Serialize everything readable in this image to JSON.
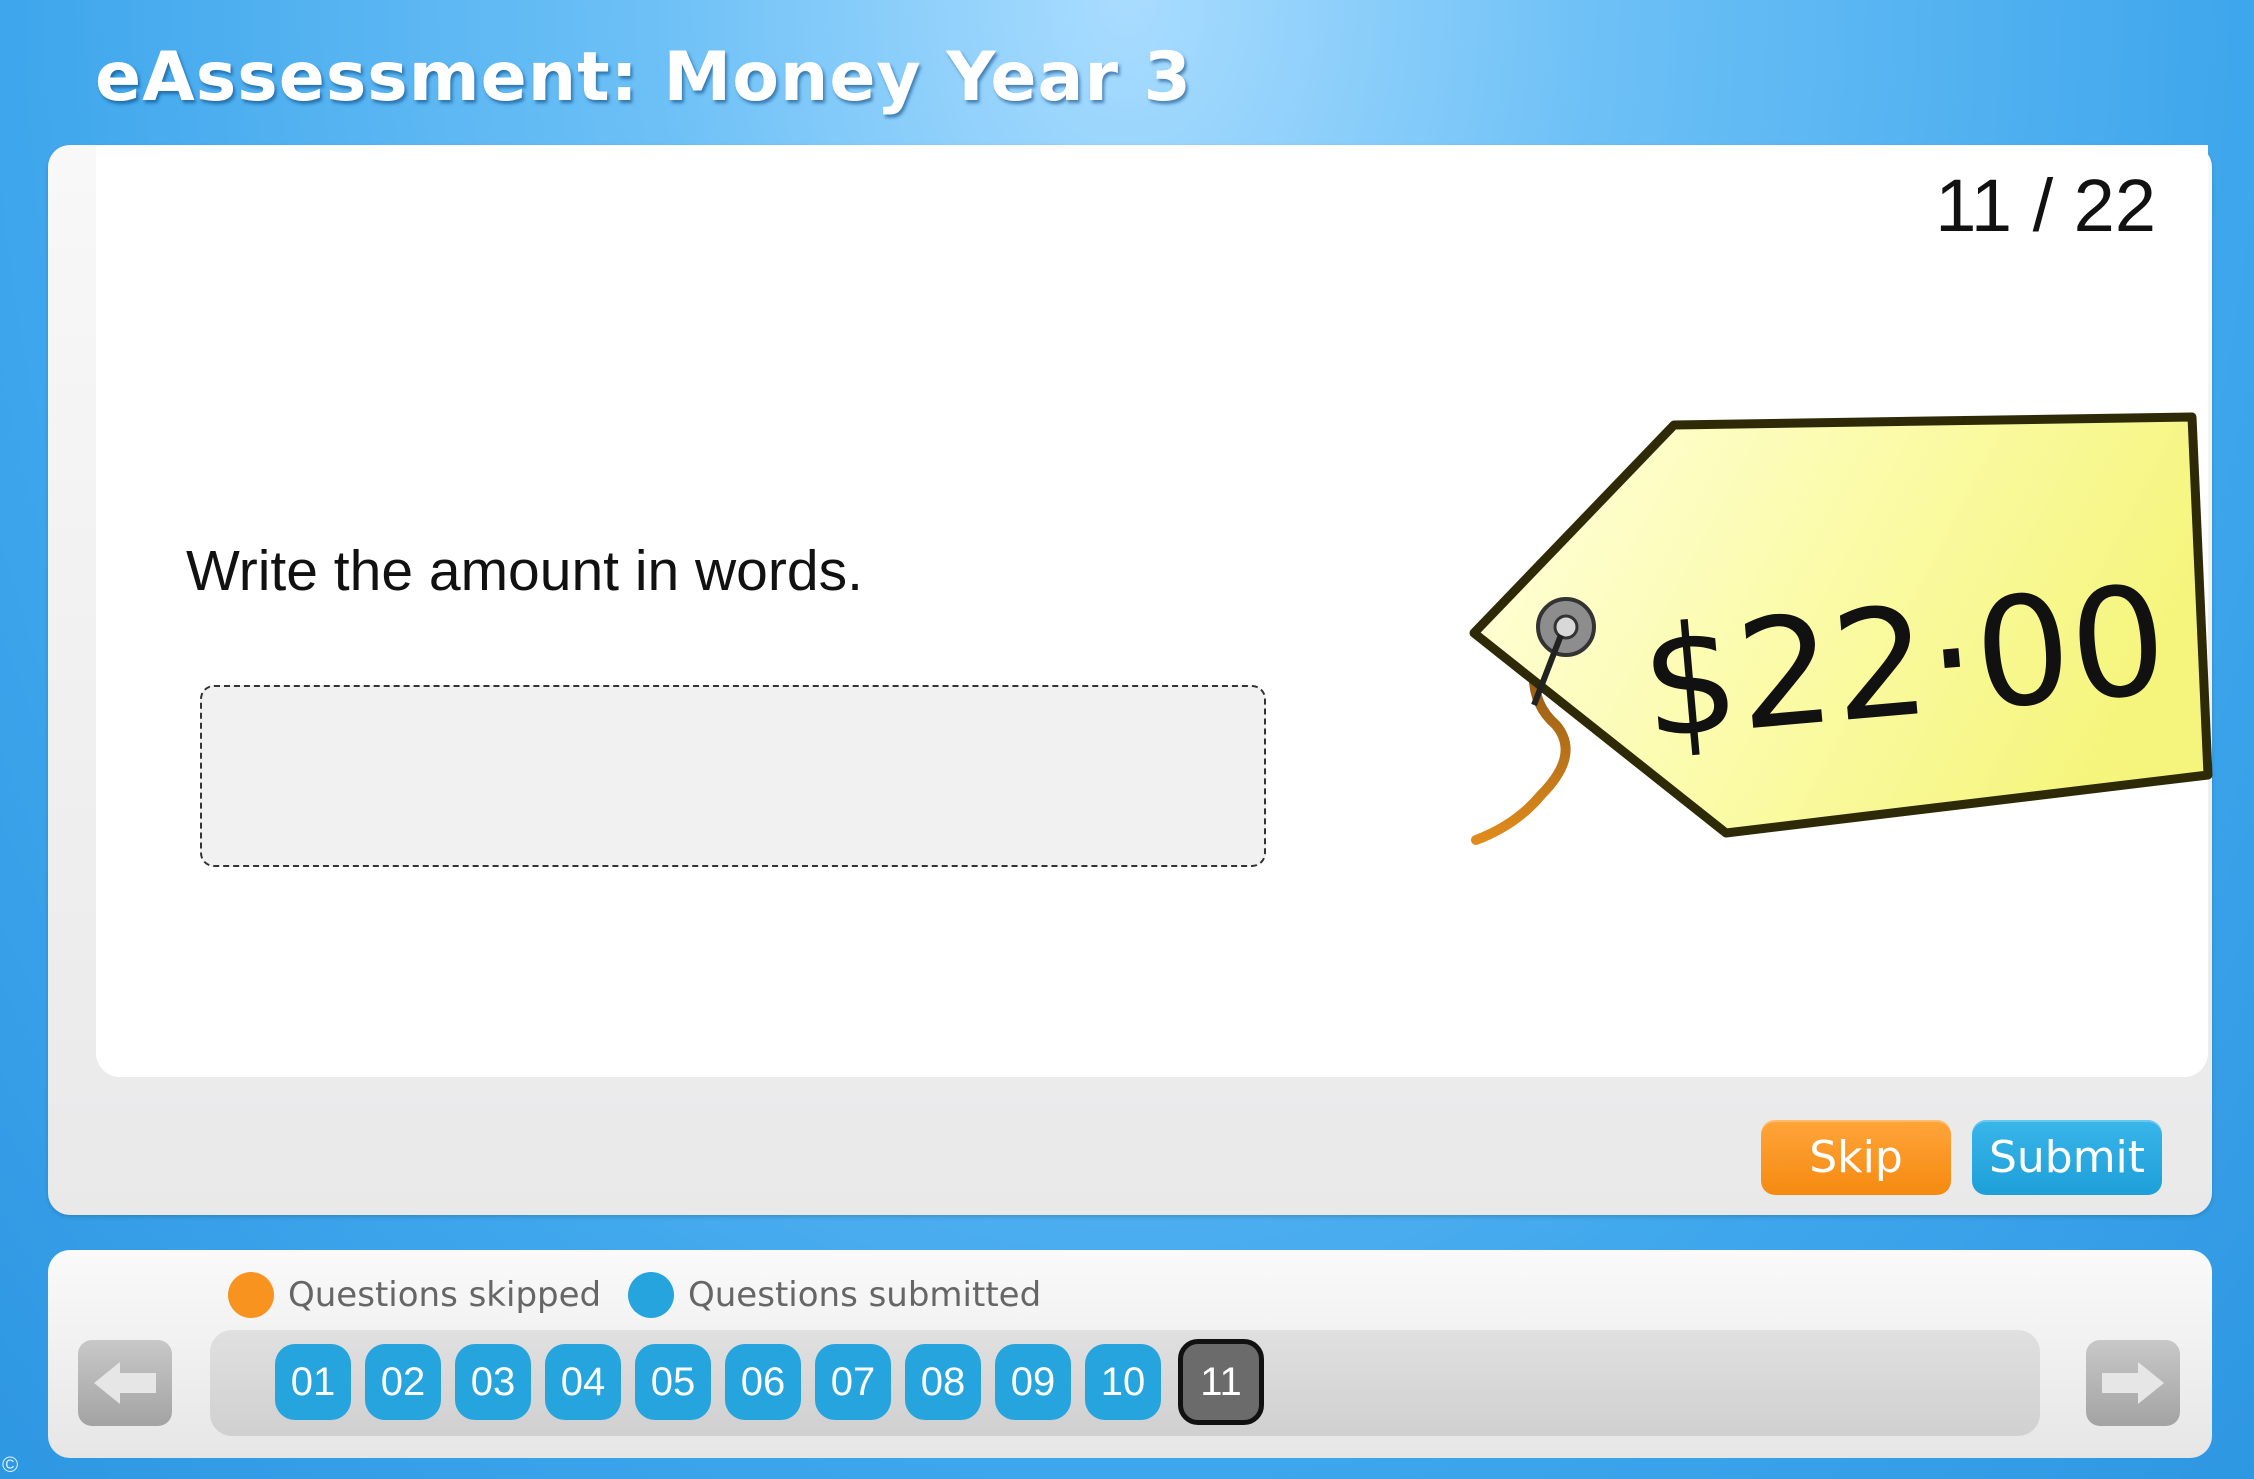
{
  "app": {
    "title": "eAssessment: Money Year 3"
  },
  "question": {
    "counter": "11 / 22",
    "prompt": "Write the amount in words.",
    "answer_value": "",
    "price_tag_text": "$22·00"
  },
  "actions": {
    "skip_label": "Skip",
    "submit_label": "Submit"
  },
  "legend": {
    "skipped_label": "Questions skipped",
    "submitted_label": "Questions submitted"
  },
  "questions_nav": {
    "items": [
      "01",
      "02",
      "03",
      "04",
      "05",
      "06",
      "07",
      "08",
      "09",
      "10",
      "11"
    ],
    "current": "11"
  },
  "colors": {
    "skipped": "#f7931e",
    "submitted": "#25a4de",
    "current": "#6b6b6b"
  },
  "footer": {
    "copyright_symbol": "©"
  }
}
